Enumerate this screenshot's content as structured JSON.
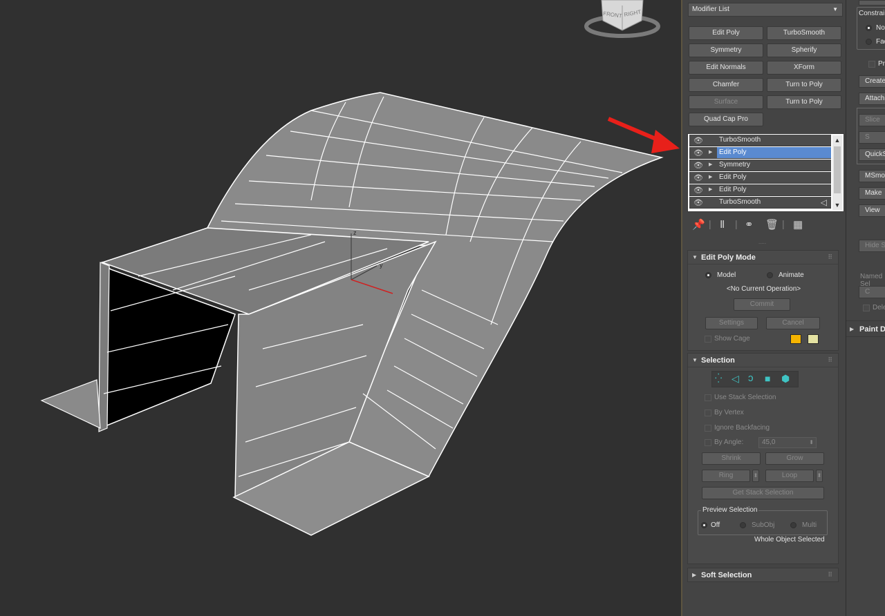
{
  "viewport": {
    "viewcube": {
      "front_label": "FRONT",
      "right_label": "RIGHT"
    },
    "axis_labels": {
      "z": "z",
      "y": "y"
    }
  },
  "modifier_list": {
    "label": "Modifier List",
    "arrow": "▼"
  },
  "modifier_buttons": [
    {
      "label": "Edit Poly"
    },
    {
      "label": "TurboSmooth"
    },
    {
      "label": "Symmetry"
    },
    {
      "label": "Spherify"
    },
    {
      "label": "Edit Normals"
    },
    {
      "label": "XForm"
    },
    {
      "label": "Chamfer"
    },
    {
      "label": "Turn to Poly"
    },
    {
      "label": "Surface"
    },
    {
      "label": "Turn to Poly"
    },
    {
      "label": "Quad Cap Pro"
    }
  ],
  "stack": [
    {
      "label": "TurboSmooth",
      "eye": "👁",
      "expand": ""
    },
    {
      "label": "Edit Poly",
      "eye": "👁",
      "expand": "▶"
    },
    {
      "label": "Symmetry",
      "eye": "👁",
      "expand": "▶"
    },
    {
      "label": "Edit Poly",
      "eye": "👁",
      "expand": "▶"
    },
    {
      "label": "Edit Poly",
      "eye": "👁",
      "expand": "▶"
    },
    {
      "label": "TurboSmooth",
      "eye": "👁",
      "expand": "",
      "tri": "◁"
    }
  ],
  "stack_toolbar": {
    "pin": "📌",
    "show_end": "Ⅱ",
    "unique": "⚭",
    "remove": "🗑",
    "configure": "▦",
    "grip": "....."
  },
  "edit_poly_mode": {
    "title": "Edit Poly Mode",
    "model_label": "Model",
    "animate_label": "Animate",
    "current_op": "<No Current Operation>",
    "commit": "Commit",
    "settings": "Settings",
    "cancel": "Cancel",
    "show_cage": "Show Cage",
    "cage_color_1": "#f5b400",
    "cage_color_2": "#e4e2a2"
  },
  "selection": {
    "title": "Selection",
    "use_stack": "Use Stack Selection",
    "by_vertex": "By Vertex",
    "ignore_backfacing": "Ignore Backfacing",
    "by_angle": "By Angle:",
    "angle_value": "45,0",
    "shrink": "Shrink",
    "grow": "Grow",
    "ring": "Ring",
    "loop": "Loop",
    "get_stack": "Get Stack Selection",
    "preview_title": "Preview Selection",
    "preview_off": "Off",
    "preview_subobj": "SubObj",
    "preview_multi": "Multi",
    "status": "Whole Object Selected"
  },
  "soft_selection": {
    "title": "Soft Selection"
  },
  "side_panel": {
    "constraints": "Constraints",
    "none": "None",
    "face": "Face",
    "preserve": "Preserve",
    "create": "Create",
    "attach": "Attach",
    "slice": "Slice",
    "s": "S",
    "quick": "QuickSlice",
    "msmooth": "MSmooth",
    "make": "Make",
    "view": "View",
    "hide": "Hide S",
    "named": "Named Sel",
    "c": "C",
    "delete": "Delete",
    "paint": "Paint Deformation"
  },
  "colors": {
    "accent": "#5a8ad0",
    "arrow": "#e8201a",
    "panel": "#444444"
  }
}
